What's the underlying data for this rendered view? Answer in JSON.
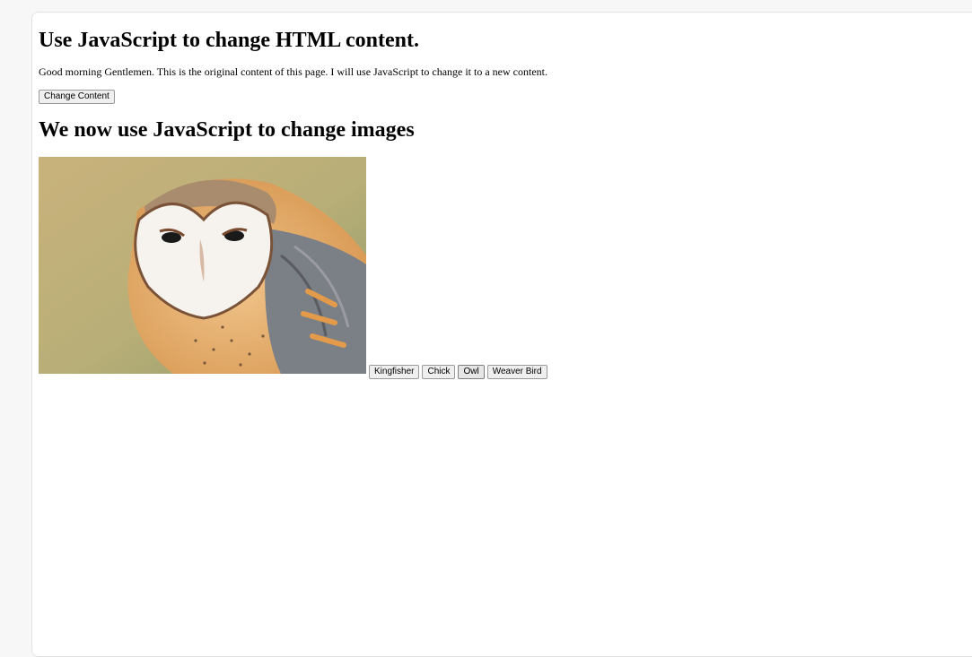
{
  "page": {
    "heading_content": "Use JavaScript to change HTML content.",
    "intro_text": "Good morning Gentlemen. This is the original content of this page. I will use JavaScript to change it to a new content.",
    "change_button_label": "Change Content",
    "heading_images": "We now use JavaScript to change images"
  },
  "image": {
    "alt": "Owl",
    "subject": "barn-owl-photo",
    "colors": {
      "background": "#b6ac74",
      "face": "#f6f3ee",
      "plumage": "#e3a65f",
      "wing": "#7d7f83"
    }
  },
  "image_buttons": [
    {
      "label": "Kingfisher"
    },
    {
      "label": "Chick"
    },
    {
      "label": "Owl",
      "selected": true
    },
    {
      "label": "Weaver Bird"
    }
  ]
}
